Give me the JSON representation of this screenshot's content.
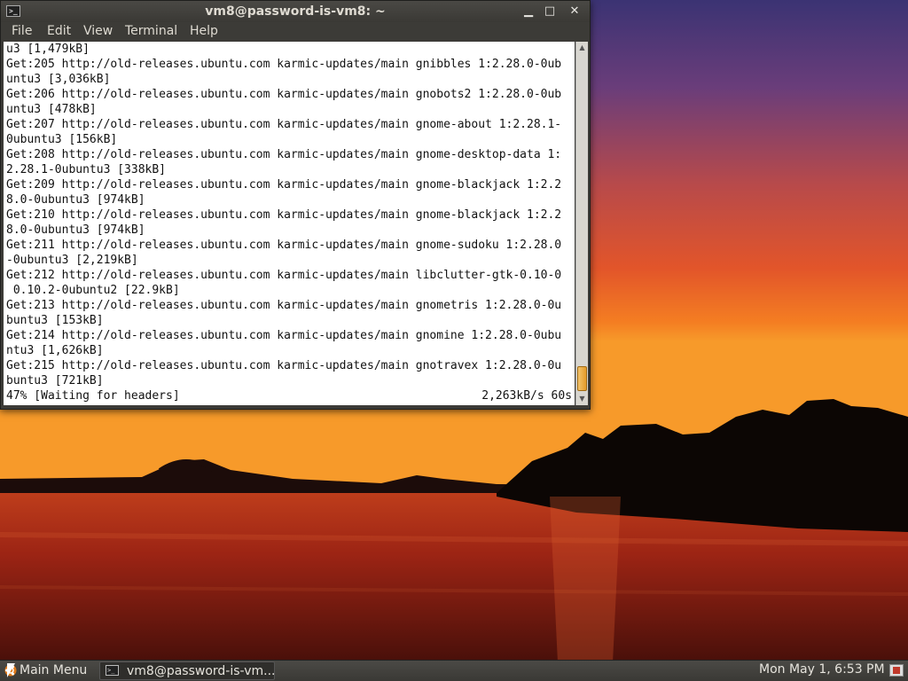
{
  "window": {
    "title": "vm8@password-is-vm8: ~",
    "icon": "terminal-icon",
    "controls": [
      "minimize-icon",
      "maximize-icon",
      "close-icon"
    ]
  },
  "menu": {
    "file": "File",
    "edit": "Edit",
    "view": "View",
    "terminal": "Terminal",
    "help": "Help"
  },
  "terminal": {
    "lines": [
      "u3 [1,479kB]",
      "Get:205 http://old-releases.ubuntu.com karmic-updates/main gnibbles 1:2.28.0-0ub",
      "untu3 [3,036kB]",
      "Get:206 http://old-releases.ubuntu.com karmic-updates/main gnobots2 1:2.28.0-0ub",
      "untu3 [478kB]",
      "Get:207 http://old-releases.ubuntu.com karmic-updates/main gnome-about 1:2.28.1-",
      "0ubuntu3 [156kB]",
      "Get:208 http://old-releases.ubuntu.com karmic-updates/main gnome-desktop-data 1:",
      "2.28.1-0ubuntu3 [338kB]",
      "Get:209 http://old-releases.ubuntu.com karmic-updates/main gnome-blackjack 1:2.2",
      "8.0-0ubuntu3 [974kB]",
      "Get:210 http://old-releases.ubuntu.com karmic-updates/main gnome-blackjack 1:2.2",
      "8.0-0ubuntu3 [974kB]",
      "Get:211 http://old-releases.ubuntu.com karmic-updates/main gnome-sudoku 1:2.28.0",
      "-0ubuntu3 [2,219kB]",
      "Get:212 http://old-releases.ubuntu.com karmic-updates/main libclutter-gtk-0.10-0",
      " 0.10.2-0ubuntu2 [22.9kB]",
      "Get:213 http://old-releases.ubuntu.com karmic-updates/main gnometris 1:2.28.0-0u",
      "buntu3 [153kB]",
      "Get:214 http://old-releases.ubuntu.com karmic-updates/main gnomine 1:2.28.0-0ubu",
      "ntu3 [1,626kB]",
      "Get:215 http://old-releases.ubuntu.com karmic-updates/main gnotravex 1:2.28.0-0u",
      "buntu3 [721kB]"
    ],
    "status_left": "47% [Waiting for headers]",
    "status_right": "2,263kB/s 60s"
  },
  "panel": {
    "main_menu_label": "Main Menu",
    "main_menu_icon": "ubuntu-logo-icon",
    "task_label": "vm8@password-is-vm...",
    "task_icon": "terminal-icon",
    "clock": "Mon May  1,  6:53 PM",
    "tray_icon": "notification-icon"
  },
  "colors": {
    "sky_top": "#4a3a7a",
    "sky_horizon": "#f0781e",
    "water": "#8a1a10",
    "scroll_thumb": "#e49b2a"
  }
}
